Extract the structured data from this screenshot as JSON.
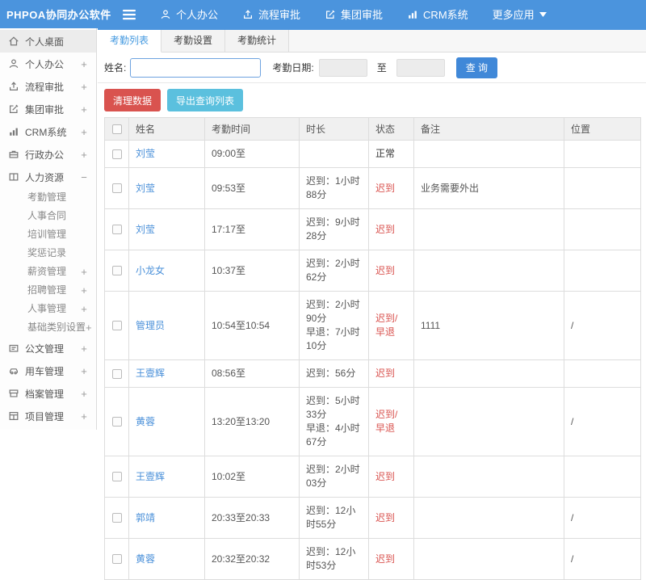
{
  "topbar": {
    "logo": "PHPOA协同办公软件",
    "nav": [
      {
        "key": "personal-office",
        "icon": "user-icon",
        "label": "个人办公"
      },
      {
        "key": "workflow-approval",
        "icon": "workflow-icon",
        "label": "流程审批"
      },
      {
        "key": "group-approval",
        "icon": "edit-icon",
        "label": "集团审批"
      },
      {
        "key": "crm-system",
        "icon": "chart-icon",
        "label": "CRM系统"
      },
      {
        "key": "more-apps",
        "icon": "caret-down-icon",
        "label": "更多应用"
      }
    ]
  },
  "sidebar": {
    "items": [
      {
        "key": "personal-desktop",
        "icon": "home-icon",
        "label": "个人桌面",
        "expand": "",
        "active": true
      },
      {
        "key": "personal-office",
        "icon": "user-icon",
        "label": "个人办公",
        "expand": "+"
      },
      {
        "key": "workflow-approval",
        "icon": "workflow-icon",
        "label": "流程审批",
        "expand": "+"
      },
      {
        "key": "group-approval",
        "icon": "edit-icon",
        "label": "集团审批",
        "expand": "+"
      },
      {
        "key": "crm-system",
        "icon": "chart-icon",
        "label": "CRM系统",
        "expand": "+"
      },
      {
        "key": "admin-office",
        "icon": "briefcase-icon",
        "label": "行政办公",
        "expand": "+"
      },
      {
        "key": "human-resources",
        "icon": "book-icon",
        "label": "人力资源",
        "expand": "−",
        "children": [
          {
            "key": "attendance-management",
            "label": "考勤管理",
            "expand": ""
          },
          {
            "key": "personnel-contract",
            "label": "人事合同",
            "expand": ""
          },
          {
            "key": "training-management",
            "label": "培训管理",
            "expand": ""
          },
          {
            "key": "reward-punishment-records",
            "label": "奖惩记录",
            "expand": ""
          },
          {
            "key": "salary-management",
            "label": "薪资管理",
            "expand": "+"
          },
          {
            "key": "recruitment-management",
            "label": "招聘管理",
            "expand": "+"
          },
          {
            "key": "personnel-management",
            "label": "人事管理",
            "expand": "+"
          },
          {
            "key": "basic-category-settings",
            "label": "基础类别设置",
            "expand": "+"
          }
        ]
      },
      {
        "key": "document-management",
        "icon": "doc-icon",
        "label": "公文管理",
        "expand": "+"
      },
      {
        "key": "vehicle-management",
        "icon": "car-icon",
        "label": "用车管理",
        "expand": "+"
      },
      {
        "key": "archive-management",
        "icon": "archive-icon",
        "label": "档案管理",
        "expand": "+"
      },
      {
        "key": "project-management",
        "icon": "project-icon",
        "label": "项目管理",
        "expand": "+"
      }
    ]
  },
  "tabs": [
    {
      "key": "attendance-list",
      "label": "考勤列表",
      "active": true
    },
    {
      "key": "attendance-settings",
      "label": "考勤设置",
      "active": false
    },
    {
      "key": "attendance-statistics",
      "label": "考勤统计",
      "active": false
    }
  ],
  "filter": {
    "name_label": "姓名:",
    "name_value": "",
    "date_label": "考勤日期:",
    "date_from": "",
    "to_label": "至",
    "date_to": "",
    "search_button": "查 询"
  },
  "actions": {
    "clean_button": "清理数据",
    "export_button": "导出查询列表"
  },
  "table": {
    "columns": [
      "姓名",
      "考勤时间",
      "时长",
      "状态",
      "备注",
      "位置"
    ],
    "rows": [
      {
        "name": "刘莹",
        "time": "09:00至",
        "duration": [],
        "status": "正常",
        "status_type": "ok",
        "note": "",
        "location": ""
      },
      {
        "name": "刘莹",
        "time": "09:53至",
        "duration": [
          "迟到：1小时88分"
        ],
        "status": "迟到",
        "status_type": "late",
        "note": "业务需要外出",
        "location": ""
      },
      {
        "name": "刘莹",
        "time": "17:17至",
        "duration": [
          "迟到：9小时28分"
        ],
        "status": "迟到",
        "status_type": "late",
        "note": "",
        "location": ""
      },
      {
        "name": "小龙女",
        "time": "10:37至",
        "duration": [
          "迟到：2小时62分"
        ],
        "status": "迟到",
        "status_type": "late",
        "note": "",
        "location": ""
      },
      {
        "name": "管理员",
        "time": "10:54至10:54",
        "duration": [
          "迟到：2小时90分",
          "早退：7小时10分"
        ],
        "status": "迟到/早退",
        "status_type": "late",
        "note": "1111",
        "location": "/"
      },
      {
        "name": "王壹辉",
        "time": "08:56至",
        "duration": [
          "迟到：56分"
        ],
        "status": "迟到",
        "status_type": "late",
        "note": "",
        "location": ""
      },
      {
        "name": "黄蓉",
        "time": "13:20至13:20",
        "duration": [
          "迟到：5小时33分",
          "早退：4小时67分"
        ],
        "status": "迟到/早退",
        "status_type": "late",
        "note": "",
        "location": "/"
      },
      {
        "name": "王壹辉",
        "time": "10:02至",
        "duration": [
          "迟到：2小时03分"
        ],
        "status": "迟到",
        "status_type": "late",
        "note": "",
        "location": ""
      },
      {
        "name": "郭靖",
        "time": "20:33至20:33",
        "duration": [
          "迟到：12小时55分"
        ],
        "status": "迟到",
        "status_type": "late",
        "note": "",
        "location": "/"
      },
      {
        "name": "黄蓉",
        "time": "20:32至20:32",
        "duration": [
          "迟到：12小时53分"
        ],
        "status": "迟到",
        "status_type": "late",
        "note": "",
        "location": "/"
      }
    ]
  },
  "colors": {
    "topbar_blue": "#4b94dd",
    "tab_active_text": "#459ae0",
    "search_button_blue": "#4088d8",
    "danger_red": "#d9534f",
    "info_blue": "#5bc0de",
    "link_blue": "#4a90d9",
    "status_late_red": "#d9534f"
  }
}
